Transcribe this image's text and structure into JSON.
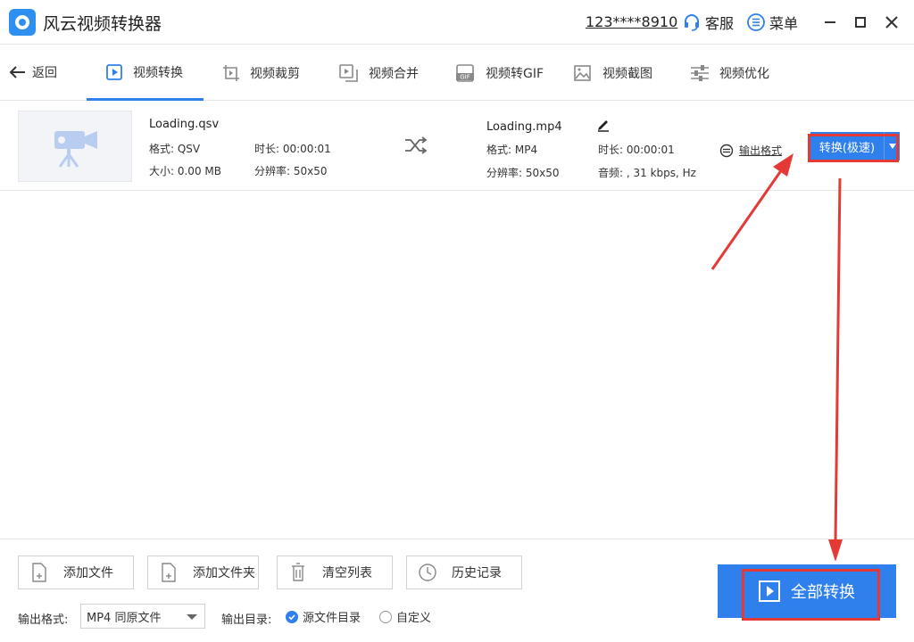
{
  "app": {
    "title": "风云视频转换器"
  },
  "titlebar": {
    "account": "123****8910",
    "service_label": "客服",
    "menu_label": "菜单"
  },
  "nav": {
    "back_label": "返回",
    "tabs": [
      {
        "label": "视频转换",
        "active": true
      },
      {
        "label": "视频裁剪"
      },
      {
        "label": "视频合并"
      },
      {
        "label": "视频转GIF"
      },
      {
        "label": "视频截图"
      },
      {
        "label": "视频优化"
      }
    ]
  },
  "file": {
    "source": {
      "name": "Loading.qsv",
      "format": "格式: QSV",
      "size": "大小: 0.00 MB",
      "duration": "时长: 00:00:01",
      "resolution": "分辨率: 50x50"
    },
    "output": {
      "name": "Loading.mp4",
      "format": "格式: MP4",
      "resolution": "分辨率: 50x50",
      "duration": "时长: 00:00:01",
      "audio": "音频: , 31 kbps,  Hz"
    },
    "output_format_label": "输出格式",
    "convert_label": "转换(极速)"
  },
  "bottom": {
    "add_file": "添加文件",
    "add_folder": "添加文件夹",
    "clear_list": "清空列表",
    "history": "历史记录",
    "output_format_label": "输出格式:",
    "output_format_value": "MP4 同原文件",
    "output_dir_label": "输出目录:",
    "radio_source": "源文件目录",
    "radio_custom": "自定义",
    "radio_selected": "源文件目录",
    "convert_all": "全部转换"
  },
  "colors": {
    "accent": "#2f80ed",
    "annotation": "#e53935"
  }
}
